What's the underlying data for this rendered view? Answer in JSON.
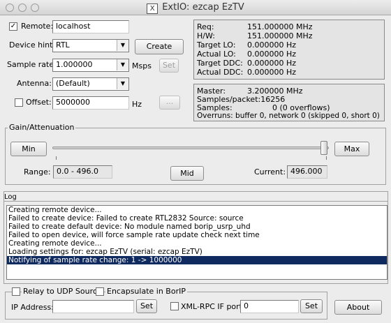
{
  "window": {
    "title": "ExtIO: ezcap EzTV",
    "app_icon": "X"
  },
  "remote": {
    "checked": true,
    "label": "Remote:",
    "host": "localhost"
  },
  "device_hint": {
    "label": "Device hint:",
    "value": "RTL",
    "create_label": "Create"
  },
  "sample_rate": {
    "label": "Sample rate:",
    "value": "1.000000",
    "unit": "Msps",
    "set_label": "Set"
  },
  "antenna": {
    "label": "Antenna:",
    "value": "(Default)"
  },
  "offset": {
    "checked": false,
    "label": "Offset:",
    "value": "5000000",
    "unit": "Hz",
    "button_label": "..."
  },
  "freq_info": [
    {
      "key": "Req:",
      "value": "151.000000 MHz"
    },
    {
      "key": "H/W:",
      "value": "151.000000 MHz"
    },
    {
      "key": "Target LO:",
      "value": "0.000000 Hz"
    },
    {
      "key": "Actual LO:",
      "value": "0.000000 Hz"
    },
    {
      "key": "Target DDC:",
      "value": "0.000000 Hz"
    },
    {
      "key": "Actual DDC:",
      "value": "0.000000 Hz"
    }
  ],
  "stream_info": {
    "master_key": "Master:",
    "master_value": "3.200000 MHz",
    "samples_packet": "Samples/packet:16256",
    "samples_key": "Samples:",
    "samples_value": "0 (0 overflows)",
    "overruns": "Overruns: buffer 0, network 0 (skipped 0, short 0)"
  },
  "gain": {
    "title": "Gain/Attenuation",
    "min_label": "Min",
    "max_label": "Max",
    "mid_label": "Mid",
    "range_label": "Range:",
    "range_value": "0.0 - 496.0",
    "current_label": "Current:",
    "current_value": "496.000",
    "slider_fraction": 1.0
  },
  "log": {
    "title": "Log",
    "lines": [
      "Creating remote device...",
      "Failed to create device: Failed to create RTL2832 Source: source",
      "Failed to create default device: No module named borip_usrp_uhd",
      "Failed to open device, will force sample rate update check next time",
      "Creating remote device...",
      "Loading settings for: ezcap EzTV (serial: ezcap EzTV)",
      "Notifying of sample rate change: 1 -> 1000000"
    ],
    "selected_index": 6
  },
  "bottom": {
    "relay_label": "Relay to UDP Source",
    "encapsulate_label": "Encapsulate in BorIP",
    "ip_label": "IP Address:",
    "ip_value": "",
    "ip_set_label": "Set",
    "xmlrpc_label": "XML-RPC IF port:",
    "xmlrpc_value": "0",
    "xmlrpc_set_label": "Set",
    "about_label": "About"
  }
}
